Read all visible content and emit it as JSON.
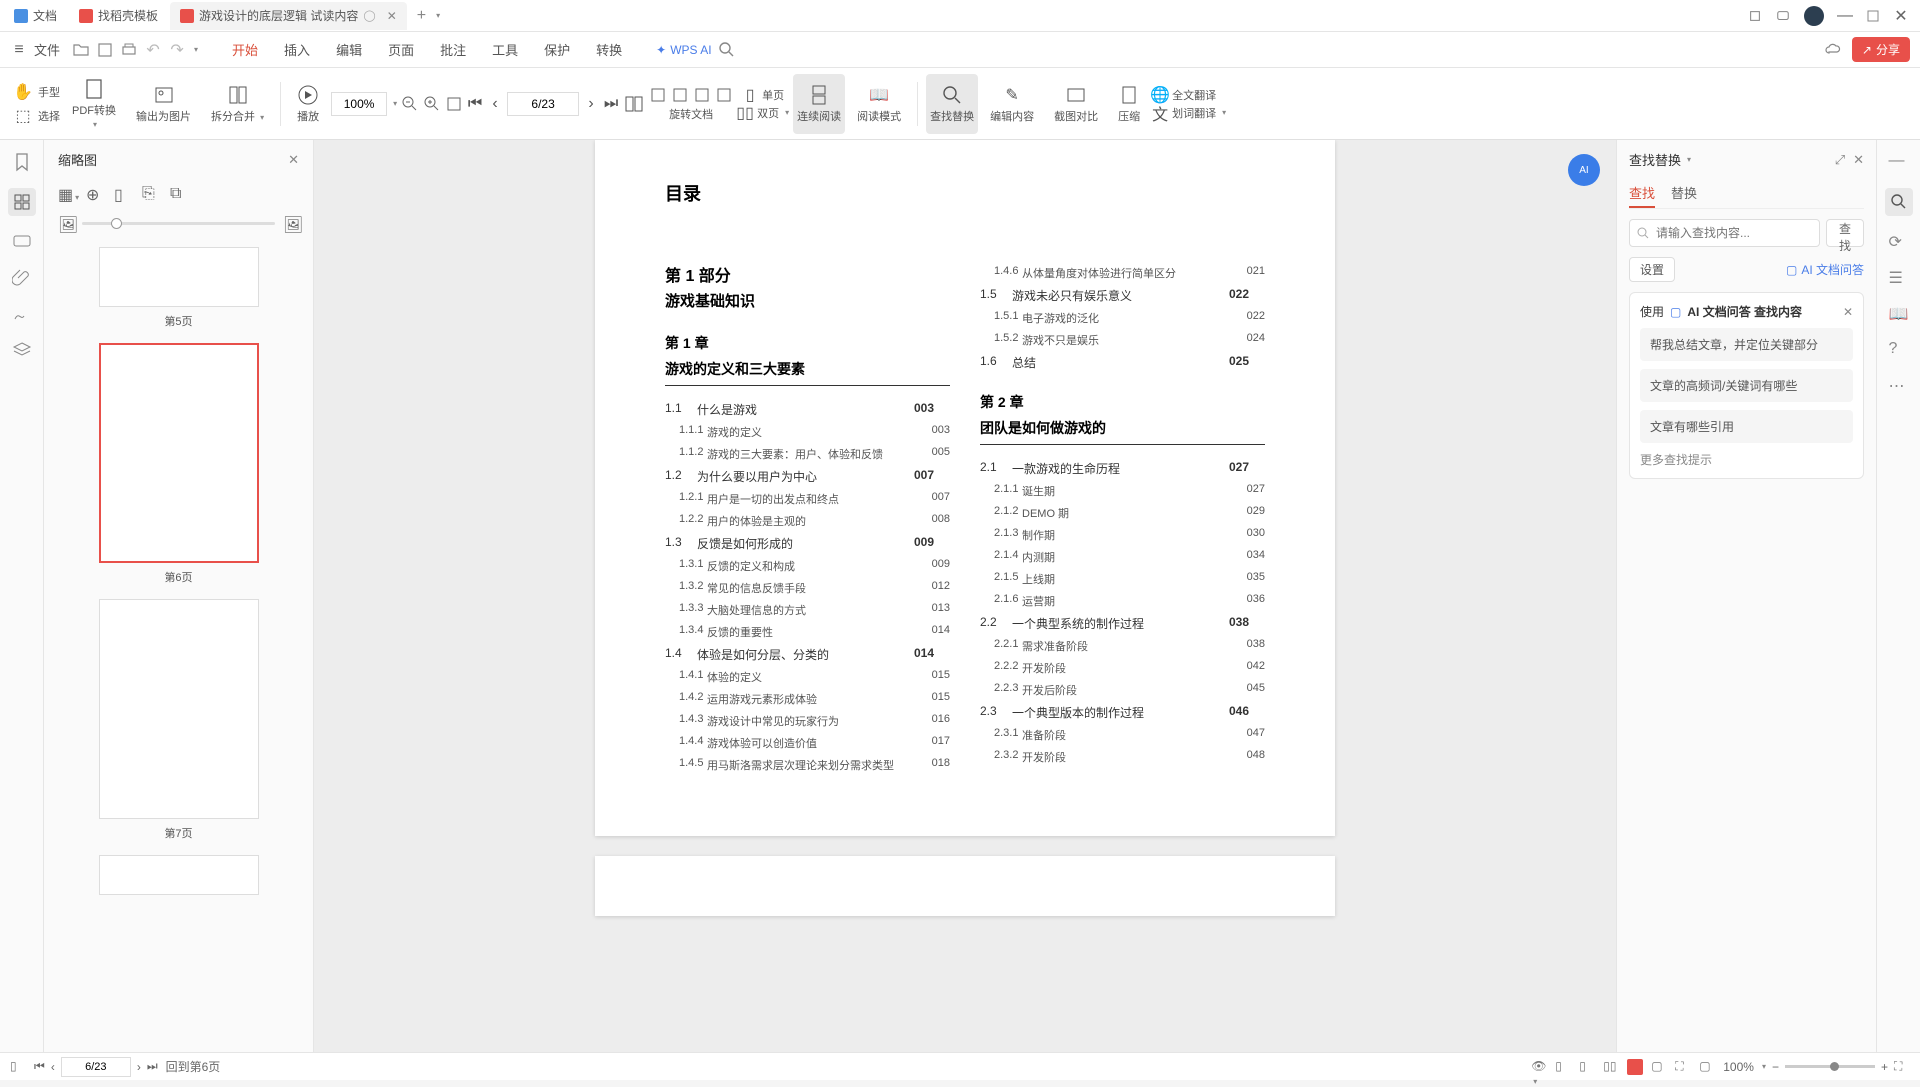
{
  "tabs": [
    {
      "label": "文档",
      "color": "#4a90e2"
    },
    {
      "label": "找稻壳模板",
      "color": "#e8504a"
    },
    {
      "label": "游戏设计的底层逻辑 试读内容",
      "color": "#e8504a",
      "active": true
    }
  ],
  "menu": {
    "file": "文件",
    "items": [
      "开始",
      "插入",
      "编辑",
      "页面",
      "批注",
      "工具",
      "保护",
      "转换"
    ],
    "active": "开始",
    "wpsai": "WPS AI",
    "share": "分享"
  },
  "toolbar": {
    "hand": "手型",
    "select": "选择",
    "pdfconv": "PDF转换",
    "exportimg": "输出为图片",
    "splitmerge": "拆分合并",
    "play": "播放",
    "zoom": "100%",
    "page": "6/23",
    "rotate": "旋转文档",
    "single": "单页",
    "double": "双页",
    "continuous": "连续阅读",
    "readmode": "阅读模式",
    "findreplace": "查找替换",
    "editcontent": "编辑内容",
    "screenshot": "截图对比",
    "compress": "压缩",
    "translate": "划词翻译",
    "fulltranslate": "全文翻译"
  },
  "thumbnails": {
    "title": "缩略图",
    "pages": [
      "第5页",
      "第6页",
      "第7页"
    ],
    "selected": 1
  },
  "doc": {
    "title": "目录",
    "part": {
      "num": "第 1 部分",
      "name": "游戏基础知识"
    },
    "chap1": {
      "num": "第 1 章",
      "name": "游戏的定义和三大要素"
    },
    "chap2": {
      "num": "第 2 章",
      "name": "团队是如何做游戏的"
    },
    "left": [
      {
        "n": "1.1",
        "t": "什么是游戏",
        "p": "003",
        "m": true
      },
      {
        "n": "1.1.1",
        "t": "游戏的定义",
        "p": "003"
      },
      {
        "n": "1.1.2",
        "t": "游戏的三大要素：用户、体验和反馈",
        "p": "005"
      },
      {
        "n": "1.2",
        "t": "为什么要以用户为中心",
        "p": "007",
        "m": true
      },
      {
        "n": "1.2.1",
        "t": "用户是一切的出发点和终点",
        "p": "007"
      },
      {
        "n": "1.2.2",
        "t": "用户的体验是主观的",
        "p": "008"
      },
      {
        "n": "1.3",
        "t": "反馈是如何形成的",
        "p": "009",
        "m": true
      },
      {
        "n": "1.3.1",
        "t": "反馈的定义和构成",
        "p": "009"
      },
      {
        "n": "1.3.2",
        "t": "常见的信息反馈手段",
        "p": "012"
      },
      {
        "n": "1.3.3",
        "t": "大脑处理信息的方式",
        "p": "013"
      },
      {
        "n": "1.3.4",
        "t": "反馈的重要性",
        "p": "014"
      },
      {
        "n": "1.4",
        "t": "体验是如何分层、分类的",
        "p": "014",
        "m": true
      },
      {
        "n": "1.4.1",
        "t": "体验的定义",
        "p": "015"
      },
      {
        "n": "1.4.2",
        "t": "运用游戏元素形成体验",
        "p": "015"
      },
      {
        "n": "1.4.3",
        "t": "游戏设计中常见的玩家行为",
        "p": "016"
      },
      {
        "n": "1.4.4",
        "t": "游戏体验可以创造价值",
        "p": "017"
      },
      {
        "n": "1.4.5",
        "t": "用马斯洛需求层次理论来划分需求类型",
        "p": "018"
      }
    ],
    "right": [
      {
        "n": "1.4.6",
        "t": "从体量角度对体验进行简单区分",
        "p": "021"
      },
      {
        "n": "1.5",
        "t": "游戏未必只有娱乐意义",
        "p": "022",
        "m": true
      },
      {
        "n": "1.5.1",
        "t": "电子游戏的泛化",
        "p": "022"
      },
      {
        "n": "1.5.2",
        "t": "游戏不只是娱乐",
        "p": "024"
      },
      {
        "n": "1.6",
        "t": "总结",
        "p": "025",
        "m": true
      },
      {
        "chap": true
      },
      {
        "n": "2.1",
        "t": "一款游戏的生命历程",
        "p": "027",
        "m": true
      },
      {
        "n": "2.1.1",
        "t": "诞生期",
        "p": "027"
      },
      {
        "n": "2.1.2",
        "t": "DEMO 期",
        "p": "029"
      },
      {
        "n": "2.1.3",
        "t": "制作期",
        "p": "030"
      },
      {
        "n": "2.1.4",
        "t": "内测期",
        "p": "034"
      },
      {
        "n": "2.1.5",
        "t": "上线期",
        "p": "035"
      },
      {
        "n": "2.1.6",
        "t": "运营期",
        "p": "036"
      },
      {
        "n": "2.2",
        "t": "一个典型系统的制作过程",
        "p": "038",
        "m": true
      },
      {
        "n": "2.2.1",
        "t": "需求准备阶段",
        "p": "038"
      },
      {
        "n": "2.2.2",
        "t": "开发阶段",
        "p": "042"
      },
      {
        "n": "2.2.3",
        "t": "开发后阶段",
        "p": "045"
      },
      {
        "n": "2.3",
        "t": "一个典型版本的制作过程",
        "p": "046",
        "m": true
      },
      {
        "n": "2.3.1",
        "t": "准备阶段",
        "p": "047"
      },
      {
        "n": "2.3.2",
        "t": "开发阶段",
        "p": "048"
      }
    ]
  },
  "findpanel": {
    "title": "查找替换",
    "tabs": [
      "查找",
      "替换"
    ],
    "placeholder": "请输入查找内容...",
    "searchbtn": "查找",
    "settings": "设置",
    "ailink": "AI 文档问答",
    "aicard": {
      "title": "使用",
      "bold": "AI 文档问答 查找内容",
      "suggestions": [
        "帮我总结文章，并定位关键部分",
        "文章的高频词/关键词有哪些",
        "文章有哪些引用"
      ],
      "more": "更多查找提示"
    }
  },
  "statusbar": {
    "page": "6/23",
    "back": "回到第6页",
    "zoom": "100%"
  }
}
